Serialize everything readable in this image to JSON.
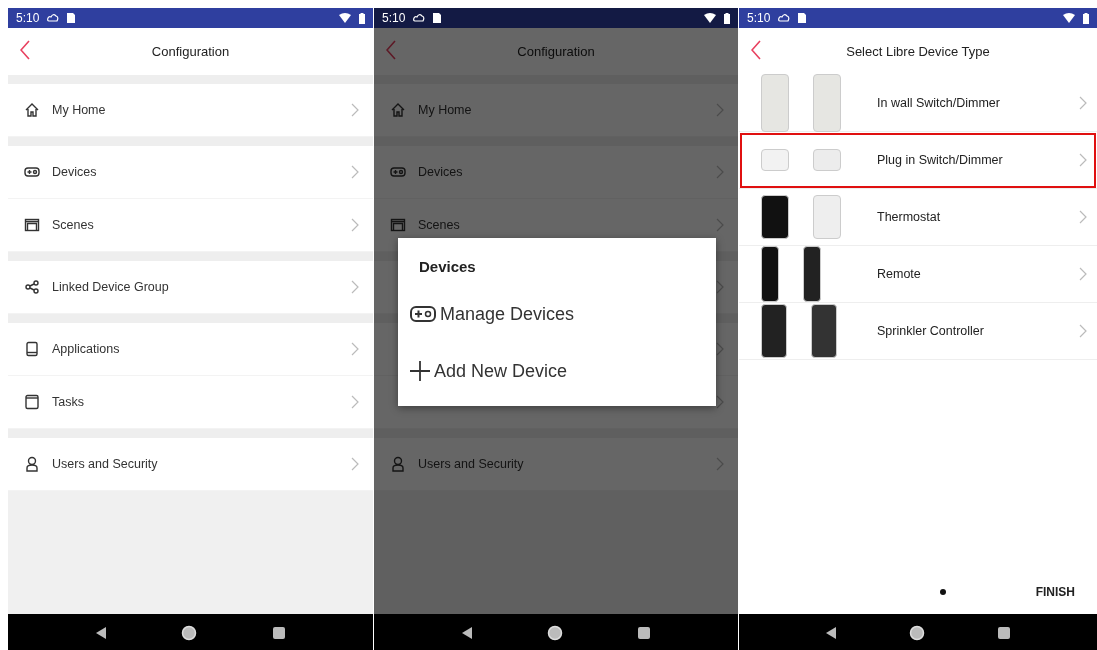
{
  "screens": [
    {
      "kind": "menu",
      "dimmed": false,
      "status_bar": {
        "time": "5:10"
      },
      "title": "Configuration",
      "groups": [
        [
          {
            "label": "My Home",
            "covered": false
          }
        ],
        [
          {
            "label": "Devices",
            "covered": false
          },
          {
            "label": "Scenes",
            "covered": false
          }
        ],
        [
          {
            "label": "Linked Device Group",
            "covered": false
          }
        ],
        [
          {
            "label": "Applications",
            "covered": false
          },
          {
            "label": "Tasks",
            "covered": false
          }
        ],
        [
          {
            "label": "Users and Security",
            "covered": false
          }
        ]
      ]
    },
    {
      "kind": "menu",
      "dimmed": true,
      "status_bar": {
        "time": "5:10"
      },
      "title": "Configuration",
      "groups": [
        [
          {
            "label": "My Home",
            "covered": false
          }
        ],
        [
          {
            "label": "Devices",
            "covered": false
          },
          {
            "label": "Scenes",
            "covered": false
          }
        ],
        [
          {
            "covered": true
          }
        ],
        [
          {
            "covered": true
          },
          {
            "covered": true
          }
        ],
        [
          {
            "label": "Users and Security",
            "covered": false
          }
        ]
      ],
      "dialog": {
        "title": "Devices",
        "options": [
          {
            "label": "Manage Devices"
          },
          {
            "label": "Add New Device"
          }
        ]
      }
    },
    {
      "kind": "device_types",
      "dimmed": false,
      "status_bar": {
        "time": "5:10"
      },
      "title": "Select Libre Device Type",
      "items": [
        {
          "label": "In wall Switch/Dimmer",
          "selected": false
        },
        {
          "label": "Plug in Switch/Dimmer",
          "selected": true
        },
        {
          "label": "Thermostat",
          "selected": false
        },
        {
          "label": "Remote",
          "selected": false
        },
        {
          "label": "Sprinkler Controller",
          "selected": false
        }
      ],
      "finish_button": "FINISH"
    }
  ]
}
